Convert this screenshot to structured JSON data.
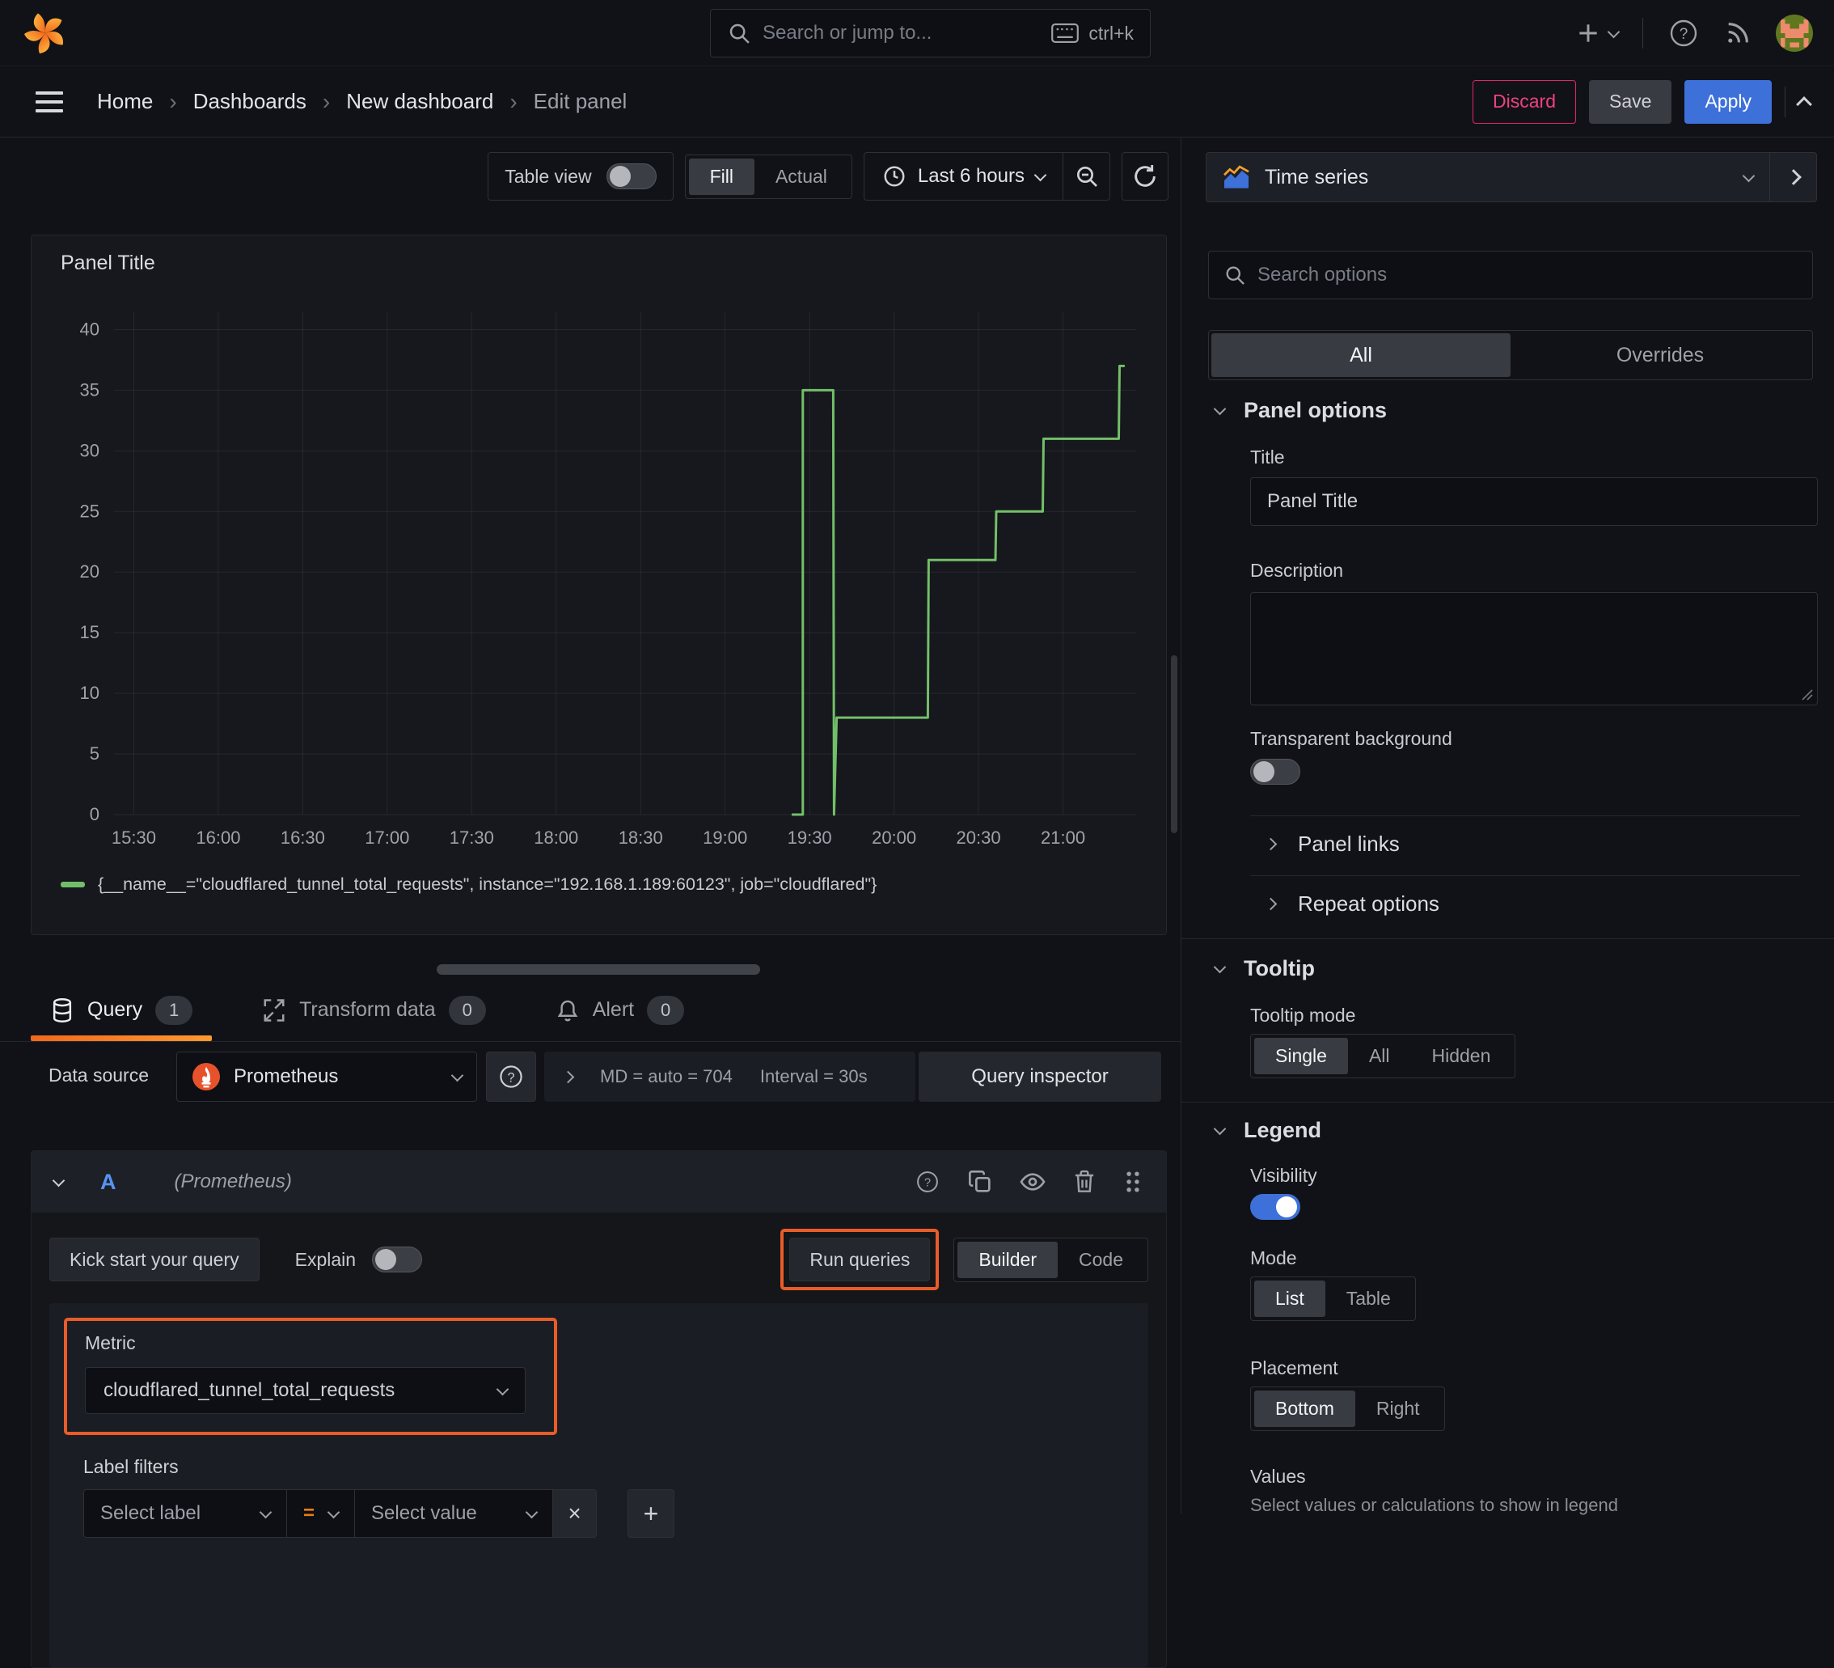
{
  "glyphs": {
    "help": "?",
    "plus": "+",
    "crumb_sep": "›",
    "close": "×",
    "shortcut_keys": "ctrl+k"
  },
  "topbar": {
    "search_placeholder": "Search or jump to..."
  },
  "nav": {
    "breadcrumbs": [
      "Home",
      "Dashboards",
      "New dashboard",
      "Edit panel"
    ],
    "discard": "Discard",
    "save": "Save",
    "apply": "Apply"
  },
  "toolbar": {
    "table_view": "Table view",
    "fill": "Fill",
    "actual": "Actual",
    "time_range": "Last 6 hours"
  },
  "viz_picker": {
    "label": "Time series"
  },
  "panel": {
    "title": "Panel Title"
  },
  "chart_data": {
    "type": "line",
    "title": "Panel Title",
    "x_ticks": [
      "15:30",
      "16:00",
      "16:30",
      "17:00",
      "17:30",
      "18:00",
      "18:30",
      "19:00",
      "19:30",
      "20:00",
      "20:30",
      "21:00"
    ],
    "x_tick_hours": [
      15.5,
      16.0,
      16.5,
      17.0,
      17.5,
      18.0,
      18.5,
      19.0,
      19.5,
      20.0,
      20.5,
      21.0
    ],
    "x_range_hours": [
      15.383,
      21.433
    ],
    "y_ticks": [
      0,
      5,
      10,
      15,
      20,
      25,
      30,
      35,
      40
    ],
    "ylim": [
      0,
      41.5
    ],
    "grid": true,
    "legend_position": "bottom",
    "series": [
      {
        "name": "{__name__=\"cloudflared_tunnel_total_requests\", instance=\"192.168.1.189:60123\", job=\"cloudflared\"}",
        "color": "#73bf69",
        "points_hour_value": [
          [
            19.4,
            0
          ],
          [
            19.46,
            0
          ],
          [
            19.46,
            35
          ],
          [
            19.64,
            35
          ],
          [
            19.645,
            0
          ],
          [
            19.66,
            8
          ],
          [
            20.2,
            8
          ],
          [
            20.205,
            21
          ],
          [
            20.6,
            21
          ],
          [
            20.605,
            25
          ],
          [
            20.88,
            25
          ],
          [
            20.885,
            31
          ],
          [
            21.33,
            31
          ],
          [
            21.335,
            37
          ],
          [
            21.36,
            37
          ]
        ]
      }
    ]
  },
  "tabs": {
    "query": "Query",
    "query_count": "1",
    "transform": "Transform data",
    "transform_count": "0",
    "alert": "Alert",
    "alert_count": "0"
  },
  "datasource": {
    "label": "Data source",
    "name": "Prometheus",
    "md": "MD = auto = 704",
    "interval": "Interval = 30s",
    "inspector": "Query inspector"
  },
  "query": {
    "ref": "A",
    "ds_hint": "(Prometheus)",
    "kickstart": "Kick start your query",
    "explain": "Explain",
    "run": "Run queries",
    "builder": "Builder",
    "code": "Code",
    "metric_label": "Metric",
    "metric_value": "cloudflared_tunnel_total_requests",
    "label_filters": "Label filters",
    "select_label": "Select label",
    "op": "=",
    "select_value": "Select value"
  },
  "sidebar": {
    "search_placeholder": "Search options",
    "tab_all": "All",
    "tab_overrides": "Overrides",
    "panel_options": {
      "heading": "Panel options",
      "title_label": "Title",
      "title_value": "Panel Title",
      "description_label": "Description",
      "transparent_label": "Transparent background"
    },
    "links_label": "Panel links",
    "repeat_label": "Repeat options",
    "tooltip": {
      "heading": "Tooltip",
      "mode_label": "Tooltip mode",
      "options": [
        "Single",
        "All",
        "Hidden"
      ]
    },
    "legend": {
      "heading": "Legend",
      "visibility_label": "Visibility",
      "mode_label": "Mode",
      "modes": [
        "List",
        "Table"
      ],
      "placement_label": "Placement",
      "placements": [
        "Bottom",
        "Right"
      ],
      "values_label": "Values",
      "values_help": "Select values or calculations to show in legend"
    }
  },
  "colors": {
    "accent_orange": "#e85c29",
    "series_green": "#73bf69",
    "primary_blue": "#3d71d9",
    "danger_pink": "#e0246e"
  }
}
